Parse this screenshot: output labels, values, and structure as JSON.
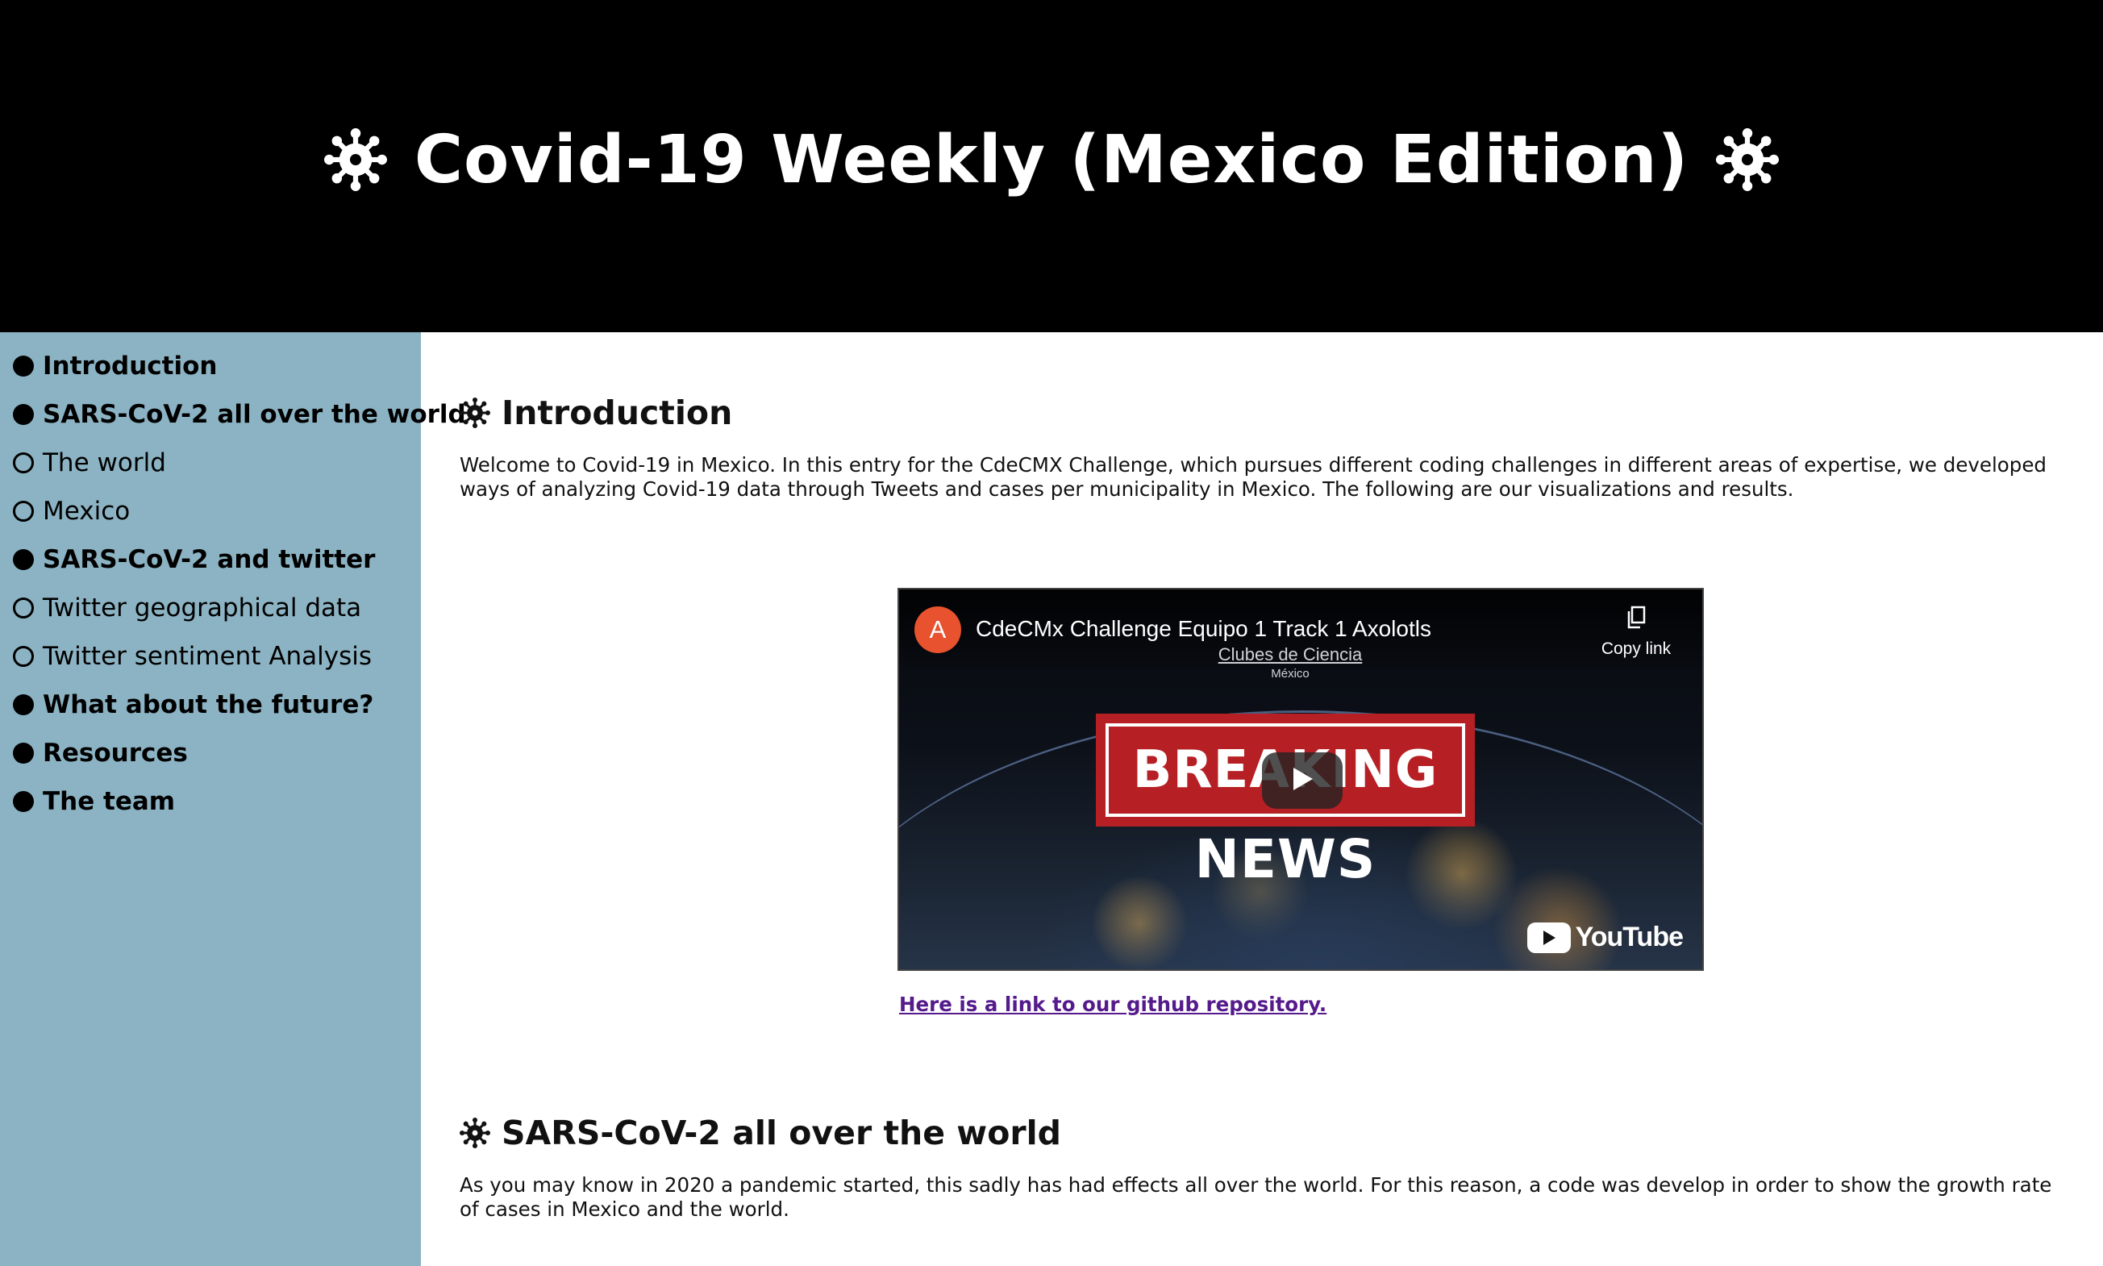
{
  "header": {
    "title": "Covid-19 Weekly (Mexico Edition)",
    "left_icon": "virus-icon",
    "right_icon": "virus-icon"
  },
  "sidebar": {
    "background": "#8cb3c3",
    "items": [
      {
        "label": "Introduction",
        "bullet": "filled",
        "level": "primary"
      },
      {
        "label": "SARS-CoV-2 all over the world",
        "bullet": "filled",
        "level": "primary"
      },
      {
        "label": "The world",
        "bullet": "hollow",
        "level": "secondary"
      },
      {
        "label": "Mexico",
        "bullet": "hollow",
        "level": "secondary"
      },
      {
        "label": "SARS-CoV-2 and twitter",
        "bullet": "filled",
        "level": "primary"
      },
      {
        "label": "Twitter geographical data",
        "bullet": "hollow",
        "level": "secondary"
      },
      {
        "label": "Twitter sentiment Analysis",
        "bullet": "hollow",
        "level": "secondary"
      },
      {
        "label": "What about the future?",
        "bullet": "filled",
        "level": "primary"
      },
      {
        "label": "Resources",
        "bullet": "filled",
        "level": "primary"
      },
      {
        "label": "The team",
        "bullet": "filled",
        "level": "primary"
      }
    ]
  },
  "main": {
    "intro": {
      "heading": "Introduction",
      "text": "Welcome to Covid-19 in Mexico. In this entry for the CdeCMX Challenge, which pursues different coding challenges in different areas of expertise, we developed ways of analyzing Covid-19 data through Tweets and cases per municipality in Mexico. The following are our visualizations and results.",
      "video": {
        "channel_initial": "A",
        "title": "CdeCMx Challenge Equipo 1 Track 1 Axolotls",
        "copy_link_label": "Copy link",
        "logo_name": "Clubes de Ciencia",
        "logo_sub": "México",
        "breaking_text": "BREAKING",
        "news_text": "NEWS",
        "youtube_label": "YouTube"
      },
      "github_link": "Here is a link to our github repository."
    },
    "world": {
      "heading": "SARS-CoV-2 all over the world",
      "text": "As you may know in 2020 a pandemic started, this sadly has had effects all over the world. For this reason, a code was develop in order to show the growth rate of cases in Mexico and the world."
    }
  },
  "colors": {
    "header_bg": "#000000",
    "link": "#551a8b",
    "breaking_red": "#b62025",
    "channel_avatar": "#e8522e"
  }
}
